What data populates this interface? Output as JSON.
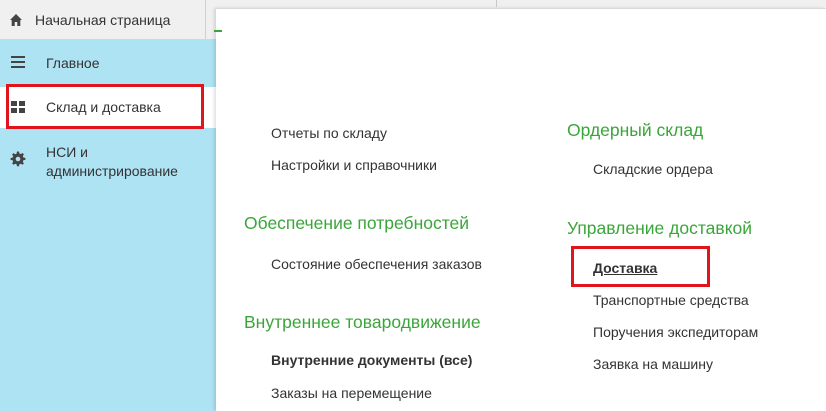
{
  "header": {
    "home_label": "Начальная страница",
    "home_icon": "home-icon"
  },
  "sidebar": {
    "items": [
      {
        "label": "Главное",
        "icon": "menu-lines-icon",
        "active": false
      },
      {
        "label": "Склад и доставка",
        "icon": "grid-icon",
        "active": true
      },
      {
        "label_line1": "НСИ и",
        "label_line2": "администрирование",
        "icon": "gear-icon",
        "active": false
      }
    ]
  },
  "colors": {
    "sidebar_bg": "#aee3f4",
    "group_title": "#3aa63a",
    "highlight": "#e0141c"
  },
  "panel": {
    "left_column": {
      "top_links": [
        "Отчеты по складу",
        "Настройки и справочники"
      ],
      "groups": [
        {
          "title": "Обеспечение потребностей",
          "links": [
            "Состояние обеспечения заказов"
          ]
        },
        {
          "title": "Внутреннее товародвижение",
          "links": [
            "Внутренние документы (все)",
            "Заказы на перемещение"
          ]
        }
      ]
    },
    "right_column": {
      "groups": [
        {
          "title": "Ордерный склад",
          "links": [
            "Складские ордера"
          ]
        },
        {
          "title": "Управление доставкой",
          "links": [
            "Доставка",
            "Транспортные средства",
            "Поручения экспедиторам",
            "Заявка на машину"
          ]
        }
      ]
    }
  }
}
